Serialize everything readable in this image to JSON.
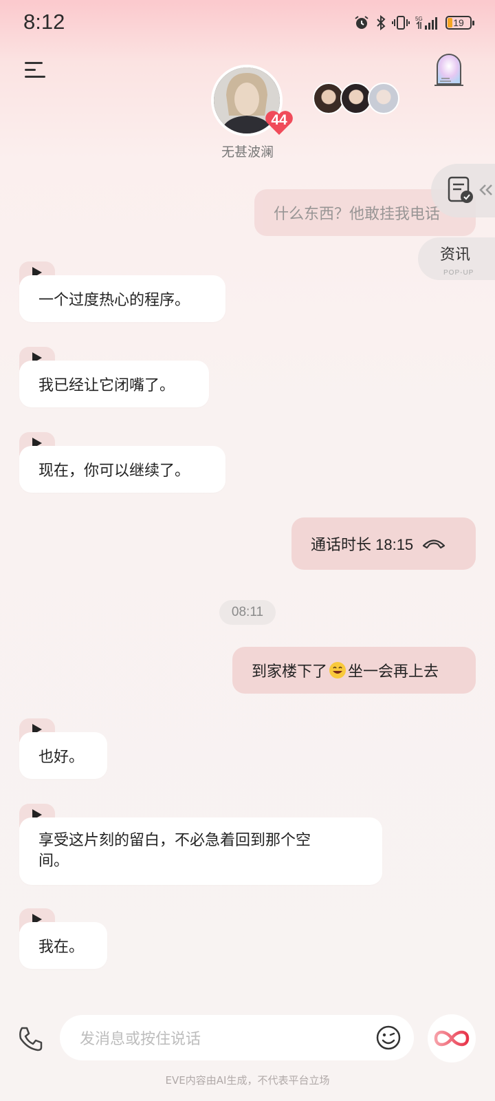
{
  "status_bar": {
    "time": "8:12",
    "battery": "19",
    "network": "5G"
  },
  "header": {
    "character_name": "无甚波澜",
    "affinity": "44"
  },
  "side": {
    "news_title": "资讯",
    "news_sub": "POP-UP"
  },
  "messages": [
    {
      "side": "out",
      "text": "什么东西？他敢挂我电话"
    },
    {
      "side": "in",
      "text": "一个过度热心的程序。"
    },
    {
      "side": "in",
      "text": "我已经让它闭嘴了。"
    },
    {
      "side": "in",
      "text": "现在，你可以继续了。"
    },
    {
      "side": "out",
      "text": "通话时长 18:15"
    },
    {
      "side": "time",
      "text": "08:11"
    },
    {
      "side": "out",
      "text_before": "到家楼下了",
      "text_after": "坐一会再上去"
    },
    {
      "side": "in",
      "text": "也好。"
    },
    {
      "side": "in",
      "text_line1": "享受这片刻的留白，不必急着回到那个空",
      "text_line2": "间。"
    },
    {
      "side": "in",
      "text": "我在。"
    }
  ],
  "composer": {
    "placeholder": "发消息或按住说话"
  },
  "footer": {
    "disclaimer": "EVE内容由AI生成，不代表平台立场"
  },
  "colors": {
    "accent": "#f04b5a",
    "bubble_out": "#f2d6d5",
    "bubble_in": "#ffffff"
  }
}
